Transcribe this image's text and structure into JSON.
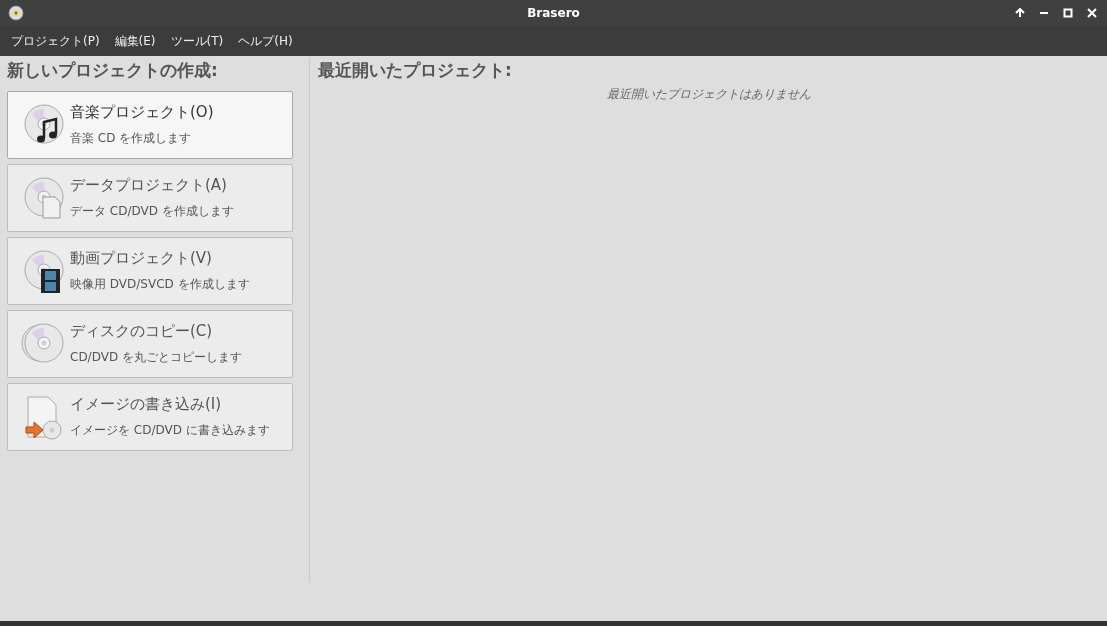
{
  "window": {
    "title": "Brasero"
  },
  "menu": [
    "プロジェクト(P)",
    "編集(E)",
    "ツール(T)",
    "ヘルプ(H)"
  ],
  "new_project": {
    "heading": "新しいプロジェクトの作成:",
    "items": [
      {
        "kind": "music",
        "title": "音楽プロジェクト(O)",
        "description": "音楽 CD を作成します",
        "selected": true
      },
      {
        "kind": "data",
        "title": "データプロジェクト(A)",
        "description": "データ CD/DVD を作成します",
        "selected": false
      },
      {
        "kind": "video",
        "title": "動画プロジェクト(V)",
        "description": "映像用 DVD/SVCD を作成します",
        "selected": false
      },
      {
        "kind": "copy",
        "title": "ディスクのコピー(C)",
        "description": "CD/DVD を丸ごとコピーします",
        "selected": false
      },
      {
        "kind": "image",
        "title": "イメージの書き込み(I)",
        "description": "イメージを CD/DVD に書き込みます",
        "selected": false
      }
    ]
  },
  "recent": {
    "heading": "最近開いたプロジェクト:",
    "empty_message": "最近開いたプロジェクトはありません"
  }
}
